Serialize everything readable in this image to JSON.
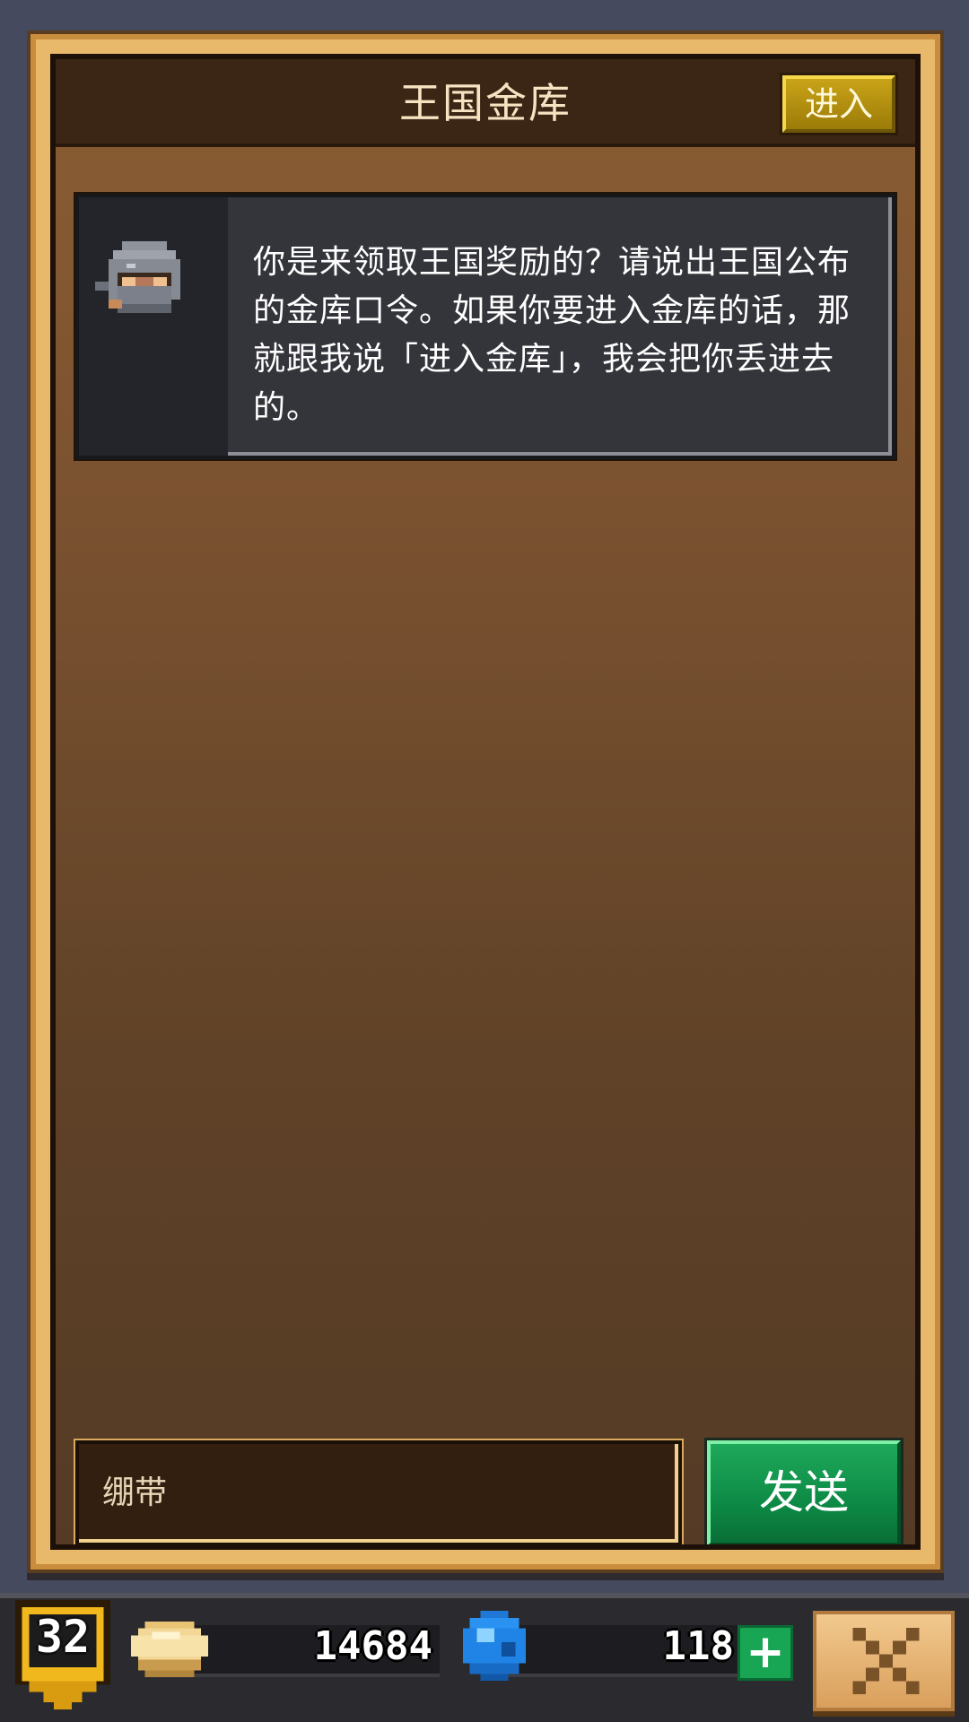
{
  "header": {
    "title": "王国金库",
    "enter_label": "进入"
  },
  "dialog": {
    "speaker_icon": "knight-npc-icon",
    "text": "你是来领取王国奖励的？请说出王国公布的金库口令。如果你要进入金库的话，那就跟我说「进入金库」，我会把你丢进去的。"
  },
  "input": {
    "value": "绷带"
  },
  "send_label": "发送",
  "hud": {
    "level": "32",
    "gold": "14684",
    "gems": "118",
    "add_gems_label": "+",
    "close_icon": "close-x-icon"
  },
  "colors": {
    "panel_wood": "#7b5230",
    "frame_gold": "#e8b96a",
    "enter_button": "#c9a318",
    "send_button": "#0d8a45",
    "dialog_bg": "#34353b"
  }
}
